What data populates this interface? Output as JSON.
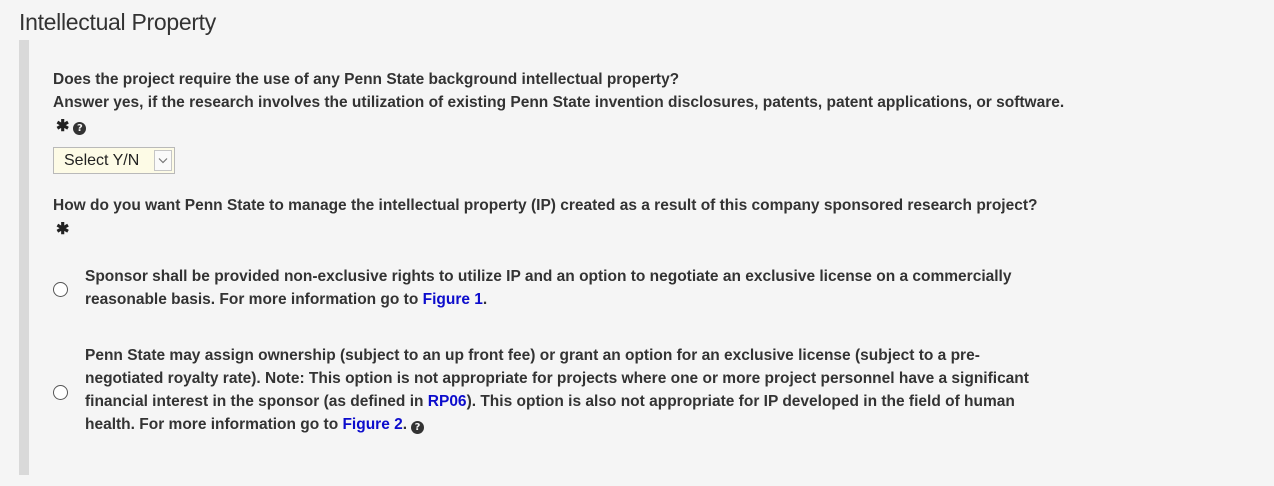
{
  "section": {
    "title": "Intellectual Property"
  },
  "question1": {
    "line1": "Does the project require the use of any Penn State background intellectual property?",
    "line2": "Answer yes, if the research involves the utilization of existing Penn State invention disclosures, patents, patent applications, or software.",
    "required_marker": "✱",
    "help_icon": "?",
    "select": {
      "selected": "Select Y/N",
      "options": [
        "Select Y/N"
      ]
    }
  },
  "question2": {
    "text": "How do you want Penn State to manage the intellectual property (IP) created as a result of this company sponsored research project?",
    "required_marker": "✱",
    "options": [
      {
        "text_before": "Sponsor shall be provided non-exclusive rights to utilize IP and an option to negotiate an exclusive license on a commercially reasonable basis. For more information go to ",
        "link": "Figure 1",
        "text_after": "."
      },
      {
        "text_before": "Penn State may assign ownership (subject to an up front fee) or grant an option for an exclusive license (subject to a pre-negotiated royalty rate). Note: This option is not appropriate for projects where one or more project personnel have a significant financial interest in the sponsor (as defined in ",
        "link_policy": "RP06",
        "text_middle": "). This option is also not appropriate for IP developed in the field of human health. For more information go to ",
        "link": "Figure 2",
        "text_after": ".",
        "help_icon": "?"
      }
    ]
  },
  "colors": {
    "link": "#0c0ccc",
    "panel_border": "#d9d9d9",
    "select_bg": "#fdfbe6"
  }
}
